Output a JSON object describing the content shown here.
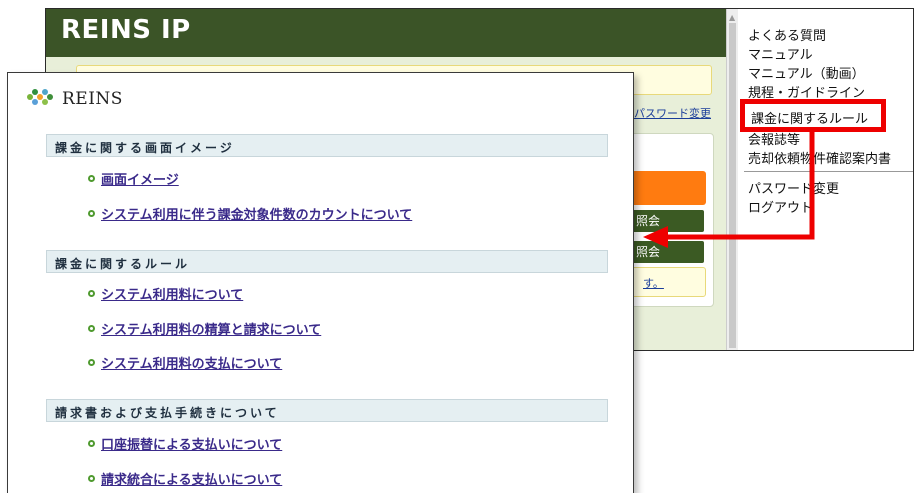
{
  "back_window": {
    "title": "REINS IP",
    "password_link": "パスワード変更",
    "button_1": "照会",
    "button_2": "照会",
    "note": "す。",
    "menu": {
      "items": [
        "よくある質問",
        "マニュアル",
        "マニュアル（動画）",
        "規程・ガイドライン",
        "会報誌等",
        "売却依頼物件確認案内書"
      ],
      "items_2": [
        "パスワード変更",
        "ログアウト"
      ]
    }
  },
  "annotation": {
    "highlight_label": "課金に関するルール",
    "color": "#ee0000"
  },
  "front_window": {
    "logo_text": "REINS",
    "sections": [
      {
        "title": "課金に関する画面イメージ",
        "links": [
          "画面イメージ",
          "システム利用に伴う課金対象件数のカウントについて"
        ]
      },
      {
        "title": "課金に関するルール",
        "links": [
          "システム利用料について",
          "システム利用料の精算と請求について",
          "システム利用料の支払について"
        ]
      },
      {
        "title": "請求書および支払手続きについて",
        "links": [
          "口座振替による支払いについて",
          "請求統合による支払いについて"
        ]
      }
    ]
  },
  "colors": {
    "header_green": "#3b5427",
    "link_purple": "#3a2a8a",
    "bullet_green": "#4f9a2f"
  }
}
